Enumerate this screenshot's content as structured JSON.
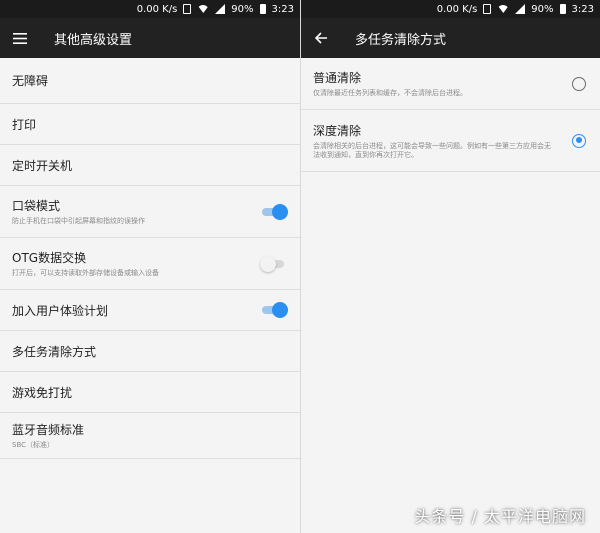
{
  "left_screen": {
    "status_bar": {
      "speed": "0.00 K/s",
      "battery": "90%",
      "time": "3:23"
    },
    "app_bar": {
      "title": "其他高级设置",
      "nav_icon": "menu-icon"
    },
    "items": [
      {
        "title": "无障碍"
      },
      {
        "title": "打印"
      },
      {
        "title": "定时开关机"
      },
      {
        "title": "口袋模式",
        "subtitle": "防止手机在口袋中引起屏幕和指纹的误操作",
        "toggle": "on"
      },
      {
        "title": "OTG数据交换",
        "subtitle": "打开后，可以支持读取外部存储设备或输入设备",
        "toggle": "off"
      },
      {
        "title": "加入用户体验计划",
        "toggle": "on"
      },
      {
        "title": "多任务清除方式"
      },
      {
        "title": "游戏免打扰"
      },
      {
        "title": "蓝牙音频标准",
        "subtitle": "SBC（标准）"
      }
    ]
  },
  "right_screen": {
    "status_bar": {
      "speed": "0.00 K/s",
      "battery": "90%",
      "time": "3:23"
    },
    "app_bar": {
      "title": "多任务清除方式",
      "nav_icon": "back-arrow-icon"
    },
    "options": [
      {
        "title": "普通清除",
        "subtitle": "仅清除最近任务列表和缓存，不会清除后台进程。",
        "checked": false
      },
      {
        "title": "深度清除",
        "subtitle": "会清除相关的后台进程，这可能会导致一些问题。例如有一些第三方应用会无法收到通知，直到你再次打开它。",
        "checked": true
      }
    ]
  },
  "colors": {
    "accent": "#2b8ff2",
    "app_bar": "#222222",
    "status_bar": "#1b1b1b",
    "background": "#f4f4f4"
  },
  "watermark": "头条号 / 太平洋电脑网"
}
